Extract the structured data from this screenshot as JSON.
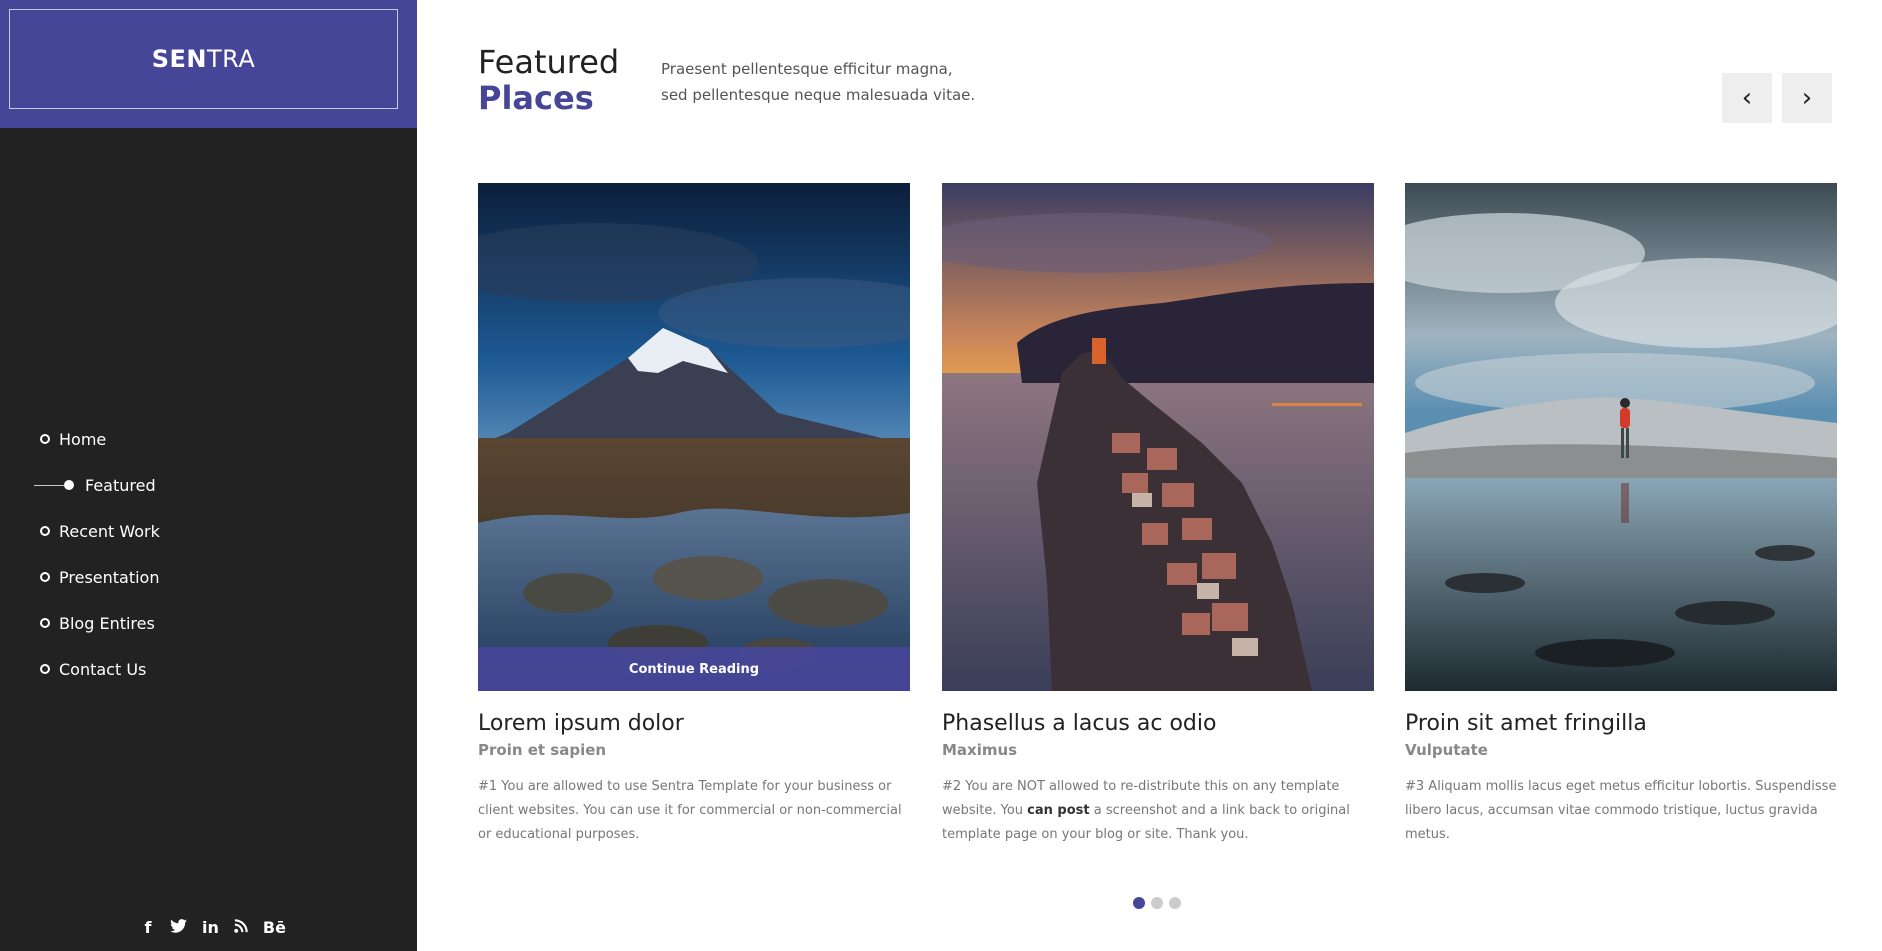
{
  "brand": {
    "bold": "SEN",
    "light": "TRA",
    "accent_color": "#464699",
    "sidebar_color": "#222222"
  },
  "nav": {
    "items": [
      {
        "label": "Home",
        "active": false
      },
      {
        "label": "Featured",
        "active": true
      },
      {
        "label": "Recent Work",
        "active": false
      },
      {
        "label": "Presentation",
        "active": false
      },
      {
        "label": "Blog Entires",
        "active": false
      },
      {
        "label": "Contact Us",
        "active": false
      }
    ]
  },
  "social": {
    "icons": [
      {
        "name": "facebook-icon",
        "glyph": "f"
      },
      {
        "name": "twitter-icon",
        "glyph": "🐦"
      },
      {
        "name": "linkedin-icon",
        "glyph": "in"
      },
      {
        "name": "rss-icon",
        "glyph": "))"
      },
      {
        "name": "behance-icon",
        "glyph": "Bē"
      }
    ]
  },
  "section": {
    "title_line1": "Featured",
    "title_line2": "Places",
    "intro_line1": "Praesent pellentesque efficitur magna,",
    "intro_line2": "sed pellentesque neque malesuada vitae."
  },
  "carousel": {
    "prev_glyph": "‹",
    "next_glyph": "›",
    "pages": 3,
    "active_page": 1
  },
  "cards": [
    {
      "image": "mountain-river-photo",
      "overlay_label": "Continue Reading",
      "title": "Lorem ipsum dolor",
      "subtitle": "Proin et sapien",
      "desc": "#1 You are allowed to use Sentra Template for your business or client websites. You can use it for commercial or non-commercial or educational purposes."
    },
    {
      "image": "coastal-village-sunset-photo",
      "title": "Phasellus a lacus ac odio",
      "subtitle": "Maximus",
      "desc_pre": "#2 You are NOT allowed to re-distribute this on any template website. You ",
      "desc_bold": "can post",
      "desc_post": " a screenshot and a link back to original template page on your blog or site. Thank you."
    },
    {
      "image": "hiker-lake-reflection-photo",
      "title": "Proin sit amet fringilla",
      "subtitle": "Vulputate",
      "desc": "#3 Aliquam mollis lacus eget metus efficitur lobortis. Suspendisse libero lacus, accumsan vitae commodo tristique, luctus gravida metus."
    }
  ]
}
